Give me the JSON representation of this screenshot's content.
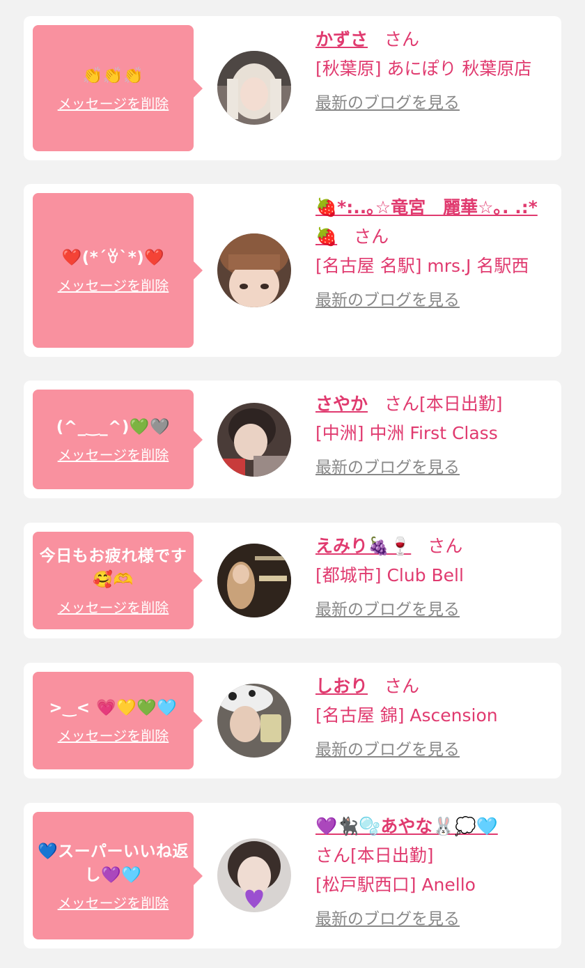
{
  "colors": {
    "page_bg": "#f2f2f2",
    "card_bg": "#ffffff",
    "bubble_bg": "#f9919f",
    "accent": "#e03a6f",
    "link_gray": "#888888"
  },
  "delete_label": "メッセージを削除",
  "blog_label": "最新のブログを見る",
  "items": [
    {
      "message": "👏👏👏",
      "name": "かずさ",
      "suffix": "さん",
      "shop": "[秋葉原] あにぽり 秋葉原店",
      "avatar_icon": "profile-photo"
    },
    {
      "message": "❤️(*´ꈊ`*)❤️",
      "name": "🍓*:..｡☆竜宮　麗華☆｡. .:*🍓",
      "suffix": "さん",
      "shop": "[名古屋 名駅] mrs.J 名駅西",
      "avatar_icon": "profile-photo"
    },
    {
      "message": "(^_‿_^)💚🩶",
      "name": "さやか",
      "suffix": "さん[本日出勤]",
      "shop": "[中洲] 中洲 First Class",
      "avatar_icon": "profile-photo"
    },
    {
      "message": "今日もお疲れ様です🥰🫶",
      "name": "えみり🍇🍷",
      "suffix": "さん",
      "shop": "[都城市] Club Bell",
      "avatar_icon": "profile-photo"
    },
    {
      "message": ">‿< 💗💛💚🩵",
      "name": "しおり",
      "suffix": "さん",
      "shop": "[名古屋 錦] Ascension",
      "avatar_icon": "profile-photo"
    },
    {
      "message": "💙スーパーいいね返し💜🩵",
      "name": "💜🐈‍⬛🫧あやな🐰💭🩵",
      "suffix": "さん[本日出勤]",
      "shop": "[松戸駅西口] Anello",
      "avatar_icon": "profile-photo"
    }
  ]
}
